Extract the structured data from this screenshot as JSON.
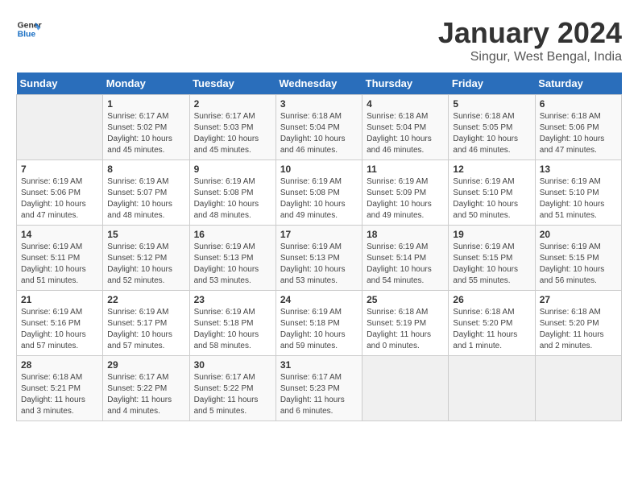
{
  "logo": {
    "line1": "General",
    "line2": "Blue"
  },
  "title": "January 2024",
  "subtitle": "Singur, West Bengal, India",
  "days_header": [
    "Sunday",
    "Monday",
    "Tuesday",
    "Wednesday",
    "Thursday",
    "Friday",
    "Saturday"
  ],
  "weeks": [
    [
      {
        "day": "",
        "info": ""
      },
      {
        "day": "1",
        "info": "Sunrise: 6:17 AM\nSunset: 5:02 PM\nDaylight: 10 hours\nand 45 minutes."
      },
      {
        "day": "2",
        "info": "Sunrise: 6:17 AM\nSunset: 5:03 PM\nDaylight: 10 hours\nand 45 minutes."
      },
      {
        "day": "3",
        "info": "Sunrise: 6:18 AM\nSunset: 5:04 PM\nDaylight: 10 hours\nand 46 minutes."
      },
      {
        "day": "4",
        "info": "Sunrise: 6:18 AM\nSunset: 5:04 PM\nDaylight: 10 hours\nand 46 minutes."
      },
      {
        "day": "5",
        "info": "Sunrise: 6:18 AM\nSunset: 5:05 PM\nDaylight: 10 hours\nand 46 minutes."
      },
      {
        "day": "6",
        "info": "Sunrise: 6:18 AM\nSunset: 5:06 PM\nDaylight: 10 hours\nand 47 minutes."
      }
    ],
    [
      {
        "day": "7",
        "info": "Sunrise: 6:19 AM\nSunset: 5:06 PM\nDaylight: 10 hours\nand 47 minutes."
      },
      {
        "day": "8",
        "info": "Sunrise: 6:19 AM\nSunset: 5:07 PM\nDaylight: 10 hours\nand 48 minutes."
      },
      {
        "day": "9",
        "info": "Sunrise: 6:19 AM\nSunset: 5:08 PM\nDaylight: 10 hours\nand 48 minutes."
      },
      {
        "day": "10",
        "info": "Sunrise: 6:19 AM\nSunset: 5:08 PM\nDaylight: 10 hours\nand 49 minutes."
      },
      {
        "day": "11",
        "info": "Sunrise: 6:19 AM\nSunset: 5:09 PM\nDaylight: 10 hours\nand 49 minutes."
      },
      {
        "day": "12",
        "info": "Sunrise: 6:19 AM\nSunset: 5:10 PM\nDaylight: 10 hours\nand 50 minutes."
      },
      {
        "day": "13",
        "info": "Sunrise: 6:19 AM\nSunset: 5:10 PM\nDaylight: 10 hours\nand 51 minutes."
      }
    ],
    [
      {
        "day": "14",
        "info": "Sunrise: 6:19 AM\nSunset: 5:11 PM\nDaylight: 10 hours\nand 51 minutes."
      },
      {
        "day": "15",
        "info": "Sunrise: 6:19 AM\nSunset: 5:12 PM\nDaylight: 10 hours\nand 52 minutes."
      },
      {
        "day": "16",
        "info": "Sunrise: 6:19 AM\nSunset: 5:13 PM\nDaylight: 10 hours\nand 53 minutes."
      },
      {
        "day": "17",
        "info": "Sunrise: 6:19 AM\nSunset: 5:13 PM\nDaylight: 10 hours\nand 53 minutes."
      },
      {
        "day": "18",
        "info": "Sunrise: 6:19 AM\nSunset: 5:14 PM\nDaylight: 10 hours\nand 54 minutes."
      },
      {
        "day": "19",
        "info": "Sunrise: 6:19 AM\nSunset: 5:15 PM\nDaylight: 10 hours\nand 55 minutes."
      },
      {
        "day": "20",
        "info": "Sunrise: 6:19 AM\nSunset: 5:15 PM\nDaylight: 10 hours\nand 56 minutes."
      }
    ],
    [
      {
        "day": "21",
        "info": "Sunrise: 6:19 AM\nSunset: 5:16 PM\nDaylight: 10 hours\nand 57 minutes."
      },
      {
        "day": "22",
        "info": "Sunrise: 6:19 AM\nSunset: 5:17 PM\nDaylight: 10 hours\nand 57 minutes."
      },
      {
        "day": "23",
        "info": "Sunrise: 6:19 AM\nSunset: 5:18 PM\nDaylight: 10 hours\nand 58 minutes."
      },
      {
        "day": "24",
        "info": "Sunrise: 6:19 AM\nSunset: 5:18 PM\nDaylight: 10 hours\nand 59 minutes."
      },
      {
        "day": "25",
        "info": "Sunrise: 6:18 AM\nSunset: 5:19 PM\nDaylight: 11 hours\nand 0 minutes."
      },
      {
        "day": "26",
        "info": "Sunrise: 6:18 AM\nSunset: 5:20 PM\nDaylight: 11 hours\nand 1 minute."
      },
      {
        "day": "27",
        "info": "Sunrise: 6:18 AM\nSunset: 5:20 PM\nDaylight: 11 hours\nand 2 minutes."
      }
    ],
    [
      {
        "day": "28",
        "info": "Sunrise: 6:18 AM\nSunset: 5:21 PM\nDaylight: 11 hours\nand 3 minutes."
      },
      {
        "day": "29",
        "info": "Sunrise: 6:17 AM\nSunset: 5:22 PM\nDaylight: 11 hours\nand 4 minutes."
      },
      {
        "day": "30",
        "info": "Sunrise: 6:17 AM\nSunset: 5:22 PM\nDaylight: 11 hours\nand 5 minutes."
      },
      {
        "day": "31",
        "info": "Sunrise: 6:17 AM\nSunset: 5:23 PM\nDaylight: 11 hours\nand 6 minutes."
      },
      {
        "day": "",
        "info": ""
      },
      {
        "day": "",
        "info": ""
      },
      {
        "day": "",
        "info": ""
      }
    ]
  ]
}
